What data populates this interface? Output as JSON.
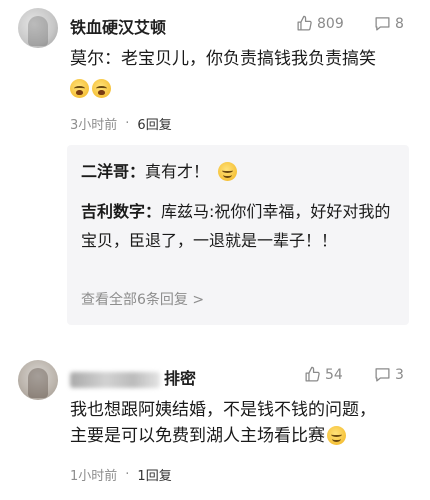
{
  "comments": [
    {
      "username": "铁血硬汉艾顿",
      "likes": "809",
      "replies_count": "8",
      "text": "莫尔：老宝贝儿，你负责搞钱我负责搞笑",
      "emojis": [
        "cry-laugh-emoji",
        "cry-laugh-emoji"
      ],
      "time": "3小时前",
      "dot": "·",
      "reply_count_label": "6回复",
      "sub_replies": [
        {
          "name": "二洋哥：",
          "text": "真有才！"
        },
        {
          "name": "吉利数字：",
          "text": "库兹马:祝你们幸福，好好对我的宝贝，臣退了，一退就是一辈子！！"
        }
      ],
      "view_all": "查看全部6条回复 >"
    },
    {
      "username_visible": "排密",
      "likes": "54",
      "replies_count": "3",
      "text": "我也想跟阿姨结婚，不是钱不钱的问题，主要是可以免费到湖人主场看比赛",
      "time": "1小时前",
      "dot": "·",
      "reply_count_label": "1回复"
    }
  ],
  "colors": {
    "muted": "#8e8e8e",
    "reply_bg": "#f5f5f7"
  }
}
